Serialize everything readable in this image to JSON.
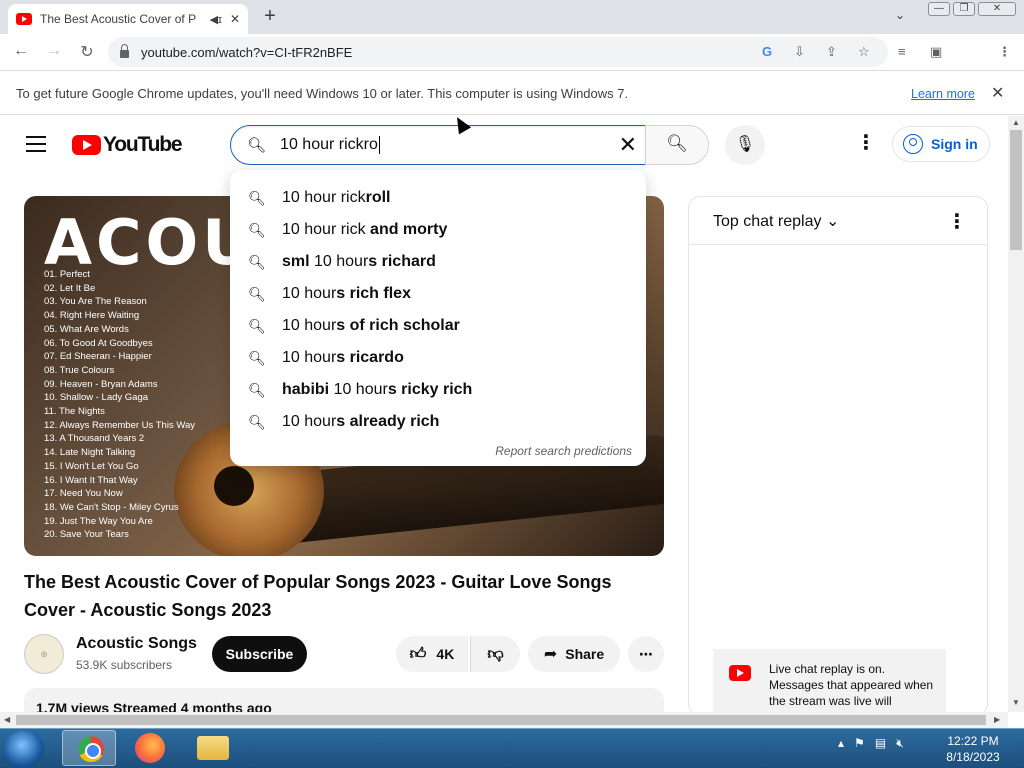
{
  "browser": {
    "tab_title": "The Best Acoustic Cover of P",
    "tab_audio_icon": "speaker-icon",
    "url": "youtube.com/watch?v=CI-tFR2nBFE",
    "infobar_text": "To get future Google Chrome updates, you'll need Windows 10 or later. This computer is using Windows 7.",
    "infobar_link": "Learn more"
  },
  "youtube": {
    "logo_text": "YouTube",
    "search_value": "10 hour rickro",
    "signin_label": "Sign in",
    "suggestions": [
      {
        "prefix": "10 hour rick",
        "bold": "roll"
      },
      {
        "prefix": "10 hour rick",
        "bold": " and morty"
      },
      {
        "prefix": "",
        "bold": "sml ",
        "prefix2": "10 hour",
        "bold2": "s richard"
      },
      {
        "prefix": "10 hour",
        "bold": "s rich flex"
      },
      {
        "prefix": "10 hour",
        "bold": "s of rich scholar"
      },
      {
        "prefix": "10 hour",
        "bold": "s ricardo"
      },
      {
        "prefix": "",
        "bold": "habibi ",
        "prefix2": "10 hour",
        "bold2": "s ricky rich"
      },
      {
        "prefix": "10 hour",
        "bold": "s already rich"
      }
    ],
    "report_label": "Report search predictions",
    "video": {
      "thumbnail_title": "ACOU",
      "tracks": [
        "01. Perfect",
        "02. Let It Be",
        "03. You Are The Reason",
        "04. Right Here Waiting",
        "05. What Are Words",
        "06. To Good At Goodbyes",
        "07. Ed Sheeran - Happier",
        "08. True Colours",
        "09. Heaven - Bryan Adams",
        "10. Shallow - Lady Gaga",
        "11. The Nights",
        "12. Always Remember Us This Way",
        "13. A Thousand Years 2",
        "14. Late Night Talking",
        "15. I Won't Let You Go",
        "16. I Want It That Way",
        "17. Need You Now",
        "18. We Can't Stop - Miley Cyrus",
        "19. Just The Way You Are",
        "20. Save Your Tears"
      ],
      "title": "The Best Acoustic Cover of Popular Songs 2023 - Guitar Love Songs Cover - Acoustic Songs 2023",
      "channel": "Acoustic Songs",
      "subscribers": "53.9K subscribers",
      "subscribe_label": "Subscribe",
      "likes": "4K",
      "share_label": "Share",
      "description_preview": "1.7M views  Streamed 4 months ago"
    },
    "chat": {
      "header": "Top chat replay",
      "replay_notice": "Live chat replay is on. Messages that appeared when the stream was live will"
    }
  },
  "taskbar": {
    "time": "12:22 PM",
    "date": "8/18/2023"
  }
}
